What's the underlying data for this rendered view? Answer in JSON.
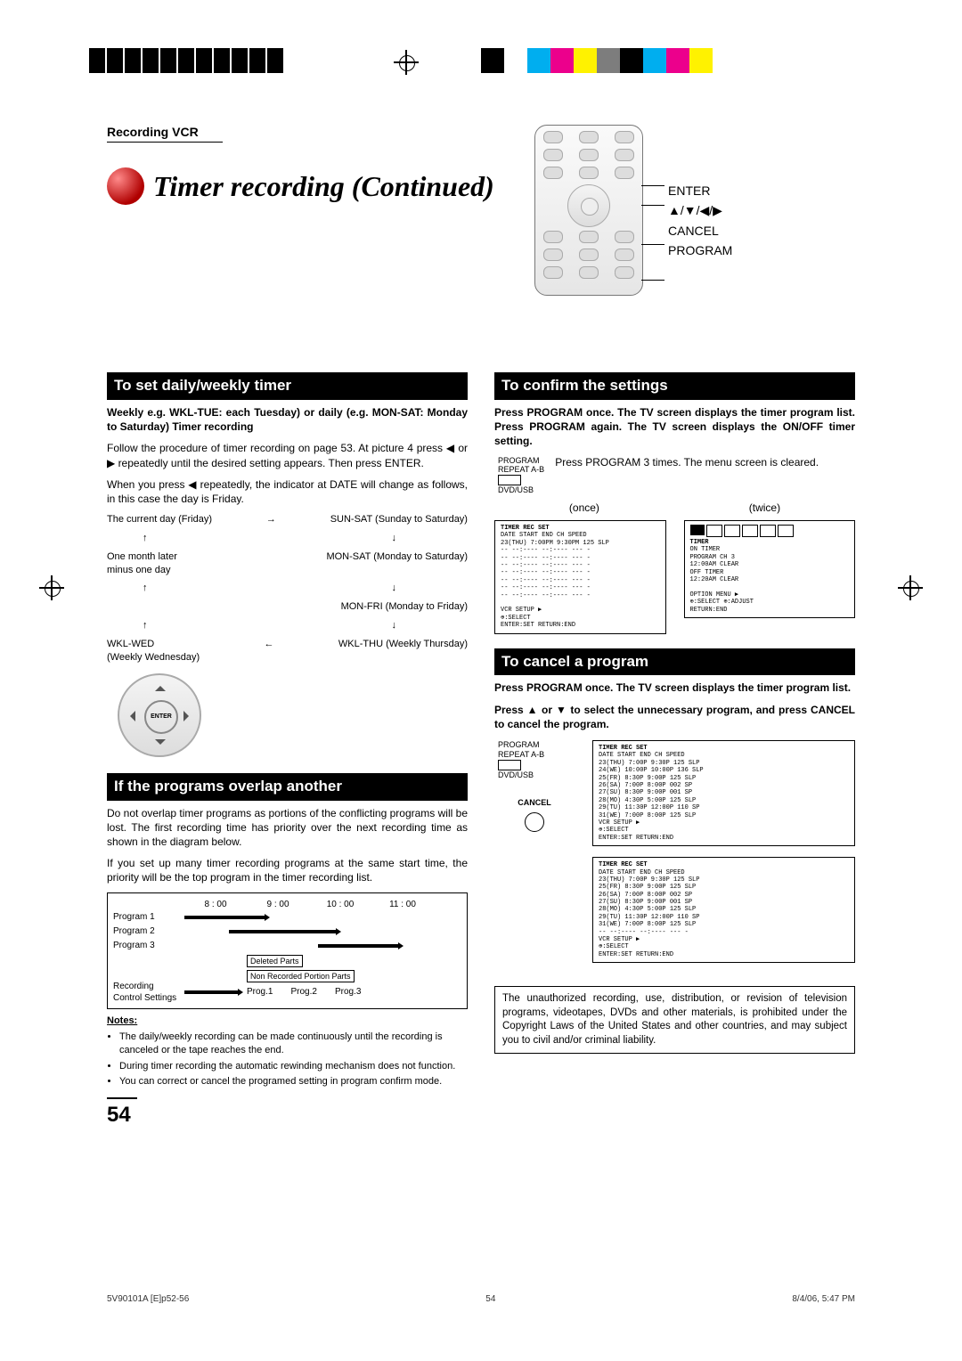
{
  "breadcrumb": "Recording VCR",
  "page_title": "Timer recording (Continued)",
  "remote_labels": {
    "enter": "ENTER",
    "arrows": "▲/▼/◀/▶",
    "cancel": "CANCEL",
    "program": "PROGRAM"
  },
  "left": {
    "section1_head": "To set daily/weekly timer",
    "s1_intro_bold": "Weekly e.g. WKL-TUE: each Tuesday) or daily (e.g. MON-SAT: Monday to Saturday) Timer recording",
    "s1_p1": "Follow the procedure of timer recording on page 53. At picture 4 press ◀ or ▶ repeatedly until the desired setting appears. Then press ENTER.",
    "s1_p2": "When you press ◀ repeatedly, the indicator at DATE will change as follows, in this case the day is Friday.",
    "cycle": {
      "r1a": "The current day (Friday)",
      "r1b": "SUN-SAT (Sunday to Saturday)",
      "mid_left_a": "One month later",
      "mid_left_b": "minus one day",
      "r2b": "MON-SAT (Monday to Saturday)",
      "r3b": "MON-FRI (Monday to Friday)",
      "r4a": "WKL-WED",
      "r4a2": "(Weekly Wednesday)",
      "r4b": "WKL-THU (Weekly Thursday)"
    },
    "enter_label": "ENTER",
    "section2_head": "If the programs overlap another",
    "s2_p1": "Do not overlap timer programs as portions of the conflicting programs will be lost. The first recording time has priority over the next recording time as shown in the diagram below.",
    "s2_p2": "If you set up many timer recording programs at the same start time, the priority will be the top program in the timer recording list.",
    "timeline": {
      "t1": "8 : 00",
      "t2": "9 : 00",
      "t3": "10 : 00",
      "t4": "11 : 00"
    },
    "prog_labels": {
      "p1": "Program 1",
      "p2": "Program 2",
      "p3": "Program 3",
      "rec": "Recording",
      "rec2": "Control Settings"
    },
    "deleted": "Deleted Parts",
    "nonrec": "Non Recorded Portion Parts",
    "rec_row": {
      "a": "Prog.1",
      "b": "Prog.2",
      "c": "Prog.3"
    },
    "notes_head": "Notes:",
    "notes": [
      "The daily/weekly recording can be made continuously until the recording is canceled or the tape reaches the end.",
      "During timer recording the automatic rewinding mechanism does not function.",
      "You can correct or cancel the programed setting in program confirm mode."
    ]
  },
  "right": {
    "section1_head": "To confirm the settings",
    "s1_bold": "Press PROGRAM once. The TV screen displays the timer program list. Press PROGRAM again. The TV screen displays the ON/OFF timer setting.",
    "indicator_lines": [
      "PROGRAM",
      "REPEAT A-B",
      "DVD/USB"
    ],
    "s1_side": "Press PROGRAM 3 times. The menu screen is cleared.",
    "caption_once": "(once)",
    "caption_twice": "(twice)",
    "screen1_title": "TIMER REC SET",
    "screen1_head": "  DATE   START   END        CH SPEED",
    "screen1_row1": "23(THU)  7:00PM 9:30PM     125  SLP",
    "screen1_dash": "  --    --:---- --:----     ---   -",
    "screen1_vcr": "VCR SETUP   ▶",
    "screen1_sel": "⊕:SELECT",
    "screen1_ent": "ENTER:SET               RETURN:END",
    "screen2_title": "TIMER",
    "screen2_l1": "ON TIMER",
    "screen2_l1a": "  PROGRAM             CH  3",
    "screen2_l1b": "  12:00AM            CLEAR",
    "screen2_l2": "OFF TIMER",
    "screen2_l2a": "  12:20AM            CLEAR",
    "screen2_opt": "OPTION MENU  ▶",
    "screen2_sel": "⊕:SELECT           ⊕:ADJUST",
    "screen2_ret": "                    RETURN:END",
    "section2_head": "To cancel a program",
    "s2_bold1": "Press PROGRAM once. The TV screen displays the timer program list.",
    "s2_bold2": "Press ▲ or ▼ to select the unnecessary program, and press CANCEL to cancel the program.",
    "cancel_label": "CANCEL",
    "table_rows": [
      "23(THU)  7:00P  9:30P   125  SLP",
      "24(WE)  10:00P 10:00P   136  SLP",
      "25(FR)   8:30P  9:00P   125  SLP",
      "26(SA)   7:00P  8:00P   002   SP",
      "27(SU)   8:30P  9:00P   001   SP",
      "28(MO)   4:30P  5:00P   125  SLP",
      "29(TU)  11:30P 12:00P   110   SP",
      "31(WE)   7:00P  8:00P   125  SLP"
    ],
    "table2_rows": [
      "23(THU)  7:00P  9:30P   125  SLP",
      "25(FR)   8:30P  9:00P   125  SLP",
      "26(SA)   7:00P  8:00P   002   SP",
      "27(SU)   8:30P  9:00P   001   SP",
      "28(MO)   4:30P  5:00P   125  SLP",
      "29(TU)  11:30P 12:00P   110   SP",
      "31(WE)   7:00P  8:00P   125  SLP"
    ],
    "copy_notice": "The unauthorized recording, use, distribution, or revision of television programs, videotapes, DVDs and other materials, is prohibited under the Copyright Laws of the United States and other countries, and may subject you to civil and/or criminal liability."
  },
  "page_number": "54",
  "footer": {
    "left": "5V90101A [E]p52-56",
    "center": "54",
    "right": "8/4/06, 5:47 PM"
  }
}
